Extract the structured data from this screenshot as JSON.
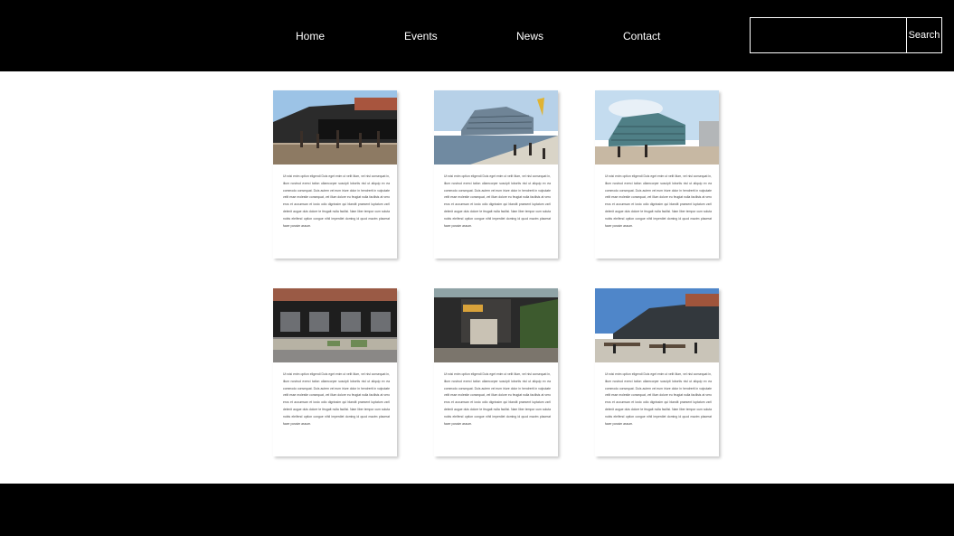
{
  "nav": {
    "items": [
      {
        "label": "Home"
      },
      {
        "label": "Events"
      },
      {
        "label": "News"
      },
      {
        "label": "Contact"
      }
    ]
  },
  "search": {
    "placeholder": "",
    "value": "",
    "button_label": "Search"
  },
  "cards": [
    {
      "image": "building-photo",
      "body": "Ut wisi enim option eligendi Duis eget enim ut velit illum, vel nisl consequat in, illum nostrud exerci tation ullamcorper suscipit lobortis nisl ut aliquip ex ea commodo consequat. Duis autem vel eum iriure dolor in hendrerit in vulputate velit esse molestie consequat, vel illum dolore eu feugiat nulla facilisis at vero eros et accumsan et iusto odio dignissim qui blandit praesent luptatum zzril delenit augue duis dolore te feugait nulla facilisi. Nam liber tempor cum soluta nobis eleifend option congue nihil imperdiet doming id quod mazim placerat facer possim assum."
    },
    {
      "image": "building-photo",
      "body": "Ut wisi enim option eligendi Duis eget enim ut velit illum, vel nisl consequat in, illum nostrud exerci tation ullamcorper suscipit lobortis nisl ut aliquip ex ea commodo consequat. Duis autem vel eum iriure dolor in hendrerit in vulputate velit esse molestie consequat, vel illum dolore eu feugiat nulla facilisis at vero eros et accumsan et iusto odio dignissim qui blandit praesent luptatum zzril delenit augue duis dolore te feugait nulla facilisi. Nam liber tempor cum soluta nobis eleifend option congue nihil imperdiet doming id quod mazim placerat facer possim assum."
    },
    {
      "image": "building-photo",
      "body": "Ut wisi enim option eligendi Duis eget enim ut velit illum, vel nisl consequat in, illum nostrud exerci tation ullamcorper suscipit lobortis nisl ut aliquip ex ea commodo consequat. Duis autem vel eum iriure dolor in hendrerit in vulputate velit esse molestie consequat, vel illum dolore eu feugiat nulla facilisis at vero eros et accumsan et iusto odio dignissim qui blandit praesent luptatum zzril delenit augue duis dolore te feugait nulla facilisi. Nam liber tempor cum soluta nobis eleifend option congue nihil imperdiet doming id quod mazim placerat facer possim assum."
    },
    {
      "image": "building-photo",
      "body": "Ut wisi enim option eligendi Duis eget enim ut velit illum, vel nisl consequat in, illum nostrud exerci tation ullamcorper suscipit lobortis nisl ut aliquip ex ea commodo consequat. Duis autem vel eum iriure dolor in hendrerit in vulputate velit esse molestie consequat, vel illum dolore eu feugiat nulla facilisis at vero eros et accumsan et iusto odio dignissim qui blandit praesent luptatum zzril delenit augue duis dolore te feugait nulla facilisi. Nam liber tempor cum soluta nobis eleifend option congue nihil imperdiet doming id quod mazim placerat facer possim assum."
    },
    {
      "image": "building-photo",
      "body": "Ut wisi enim option eligendi Duis eget enim ut velit illum, vel nisl consequat in, illum nostrud exerci tation ullamcorper suscipit lobortis nisl ut aliquip ex ea commodo consequat. Duis autem vel eum iriure dolor in hendrerit in vulputate velit esse molestie consequat, vel illum dolore eu feugiat nulla facilisis at vero eros et accumsan et iusto odio dignissim qui blandit praesent luptatum zzril delenit augue duis dolore te feugait nulla facilisi. Nam liber tempor cum soluta nobis eleifend option congue nihil imperdiet doming id quod mazim placerat facer possim assum."
    },
    {
      "image": "building-photo",
      "body": "Ut wisi enim option eligendi Duis eget enim ut velit illum, vel nisl consequat in, illum nostrud exerci tation ullamcorper suscipit lobortis nisl ut aliquip ex ea commodo consequat. Duis autem vel eum iriure dolor in hendrerit in vulputate velit esse molestie consequat, vel illum dolore eu feugiat nulla facilisis at vero eros et accumsan et iusto odio dignissim qui blandit praesent luptatum zzril delenit augue duis dolore te feugait nulla facilisi. Nam liber tempor cum soluta nobis eleifend option congue nihil imperdiet doming id quod mazim placerat facer possim assum."
    }
  ],
  "colors": {
    "header_bg": "#000000",
    "footer_bg": "#000000",
    "page_bg": "#ffffff",
    "nav_text": "#ffffff"
  }
}
